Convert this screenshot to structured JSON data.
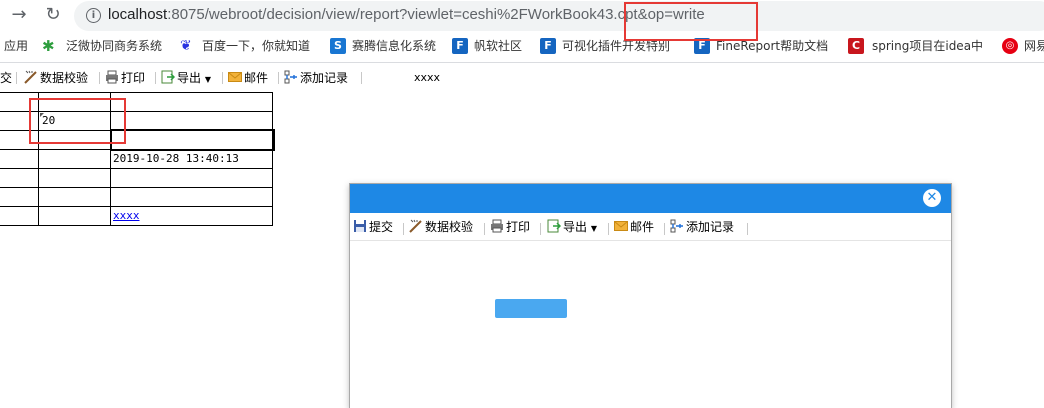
{
  "browser": {
    "url_host": "localhost",
    "url_rest": ":8075/webroot/decision/view/report?viewlet=ceshi%2FWorkBook43.cpt&op=write"
  },
  "bookmarks": [
    {
      "label": "应用",
      "icon": "apps-grid-icon"
    },
    {
      "label": "泛微协同商务系统",
      "icon": "weaver-icon",
      "color": "#2e9e3e"
    },
    {
      "label": "百度一下，你就知道",
      "icon": "baidu-paw-icon",
      "color": "#2932e1"
    },
    {
      "label": "赛腾信息化系统",
      "icon": "saiteng-s-icon",
      "color": "#1976d2"
    },
    {
      "label": "帆软社区",
      "icon": "fanruan-icon",
      "color": "#1565c0"
    },
    {
      "label": "可视化插件开发特别\u0000",
      "icon": "fanruan-icon",
      "color": "#1565c0"
    },
    {
      "label": "FineReport帮助文档",
      "icon": "fanruan-icon",
      "color": "#1565c0"
    },
    {
      "label": "spring项目在idea中",
      "icon": "csdn-c-icon",
      "color": "#c8161d"
    },
    {
      "label": "网易",
      "icon": "netease-icon",
      "color": "#e60012"
    }
  ],
  "toolbar": {
    "submit": "提交",
    "validate": "数据校验",
    "print": "打印",
    "export": "导出",
    "mail": "邮件",
    "add_record": "添加记录",
    "extra": "xxxx"
  },
  "grid": {
    "cell_value": "20",
    "timestamp": "2019-10-28 13:40:13",
    "link": "xxxx"
  },
  "dialog": {
    "toolbar": {
      "submit": "提交",
      "validate": "数据校验",
      "print": "打印",
      "export": "导出",
      "mail": "邮件",
      "add_record": "添加记录"
    }
  },
  "colors": {
    "dialog_header": "#1e88e5",
    "loading_bar": "#4aa8f0",
    "highlight": "#e53935"
  }
}
